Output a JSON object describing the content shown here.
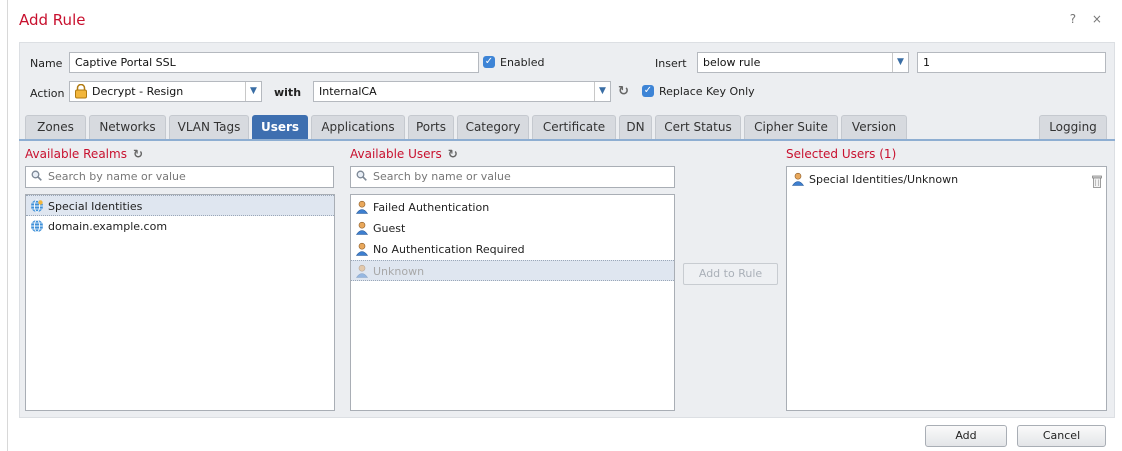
{
  "dialog": {
    "title": "Add Rule",
    "help_icons": "? ×"
  },
  "form": {
    "name_label": "Name",
    "name_value": "Captive Portal SSL",
    "enabled_label": "Enabled",
    "insert_label": "Insert",
    "insert_value": "below rule",
    "insert_number": "1",
    "action_label": "Action",
    "action_value": "Decrypt - Resign",
    "with_label": "with",
    "with_value": "InternalCA",
    "replace_key_label": "Replace Key Only"
  },
  "tabs": [
    "Zones",
    "Networks",
    "VLAN Tags",
    "Users",
    "Applications",
    "Ports",
    "Category",
    "Certificate",
    "DN",
    "Cert Status",
    "Cipher Suite",
    "Version"
  ],
  "logging_tab": "Logging",
  "realms": {
    "title": "Available Realms",
    "search_placeholder": "Search by name or value",
    "items": [
      "Special Identities",
      "domain.example.com"
    ]
  },
  "users": {
    "title": "Available Users",
    "search_placeholder": "Search by name or value",
    "items": [
      "Failed Authentication",
      "Guest",
      "No Authentication Required",
      "Unknown"
    ]
  },
  "add_to_rule_label": "Add to Rule",
  "selected": {
    "title": "Selected Users (1)",
    "items": [
      "Special Identities/Unknown"
    ]
  },
  "footer": {
    "add_label": "Add",
    "cancel_label": "Cancel"
  },
  "colors": {
    "accent": "#c8102e",
    "tab_active": "#3e6fb0"
  }
}
